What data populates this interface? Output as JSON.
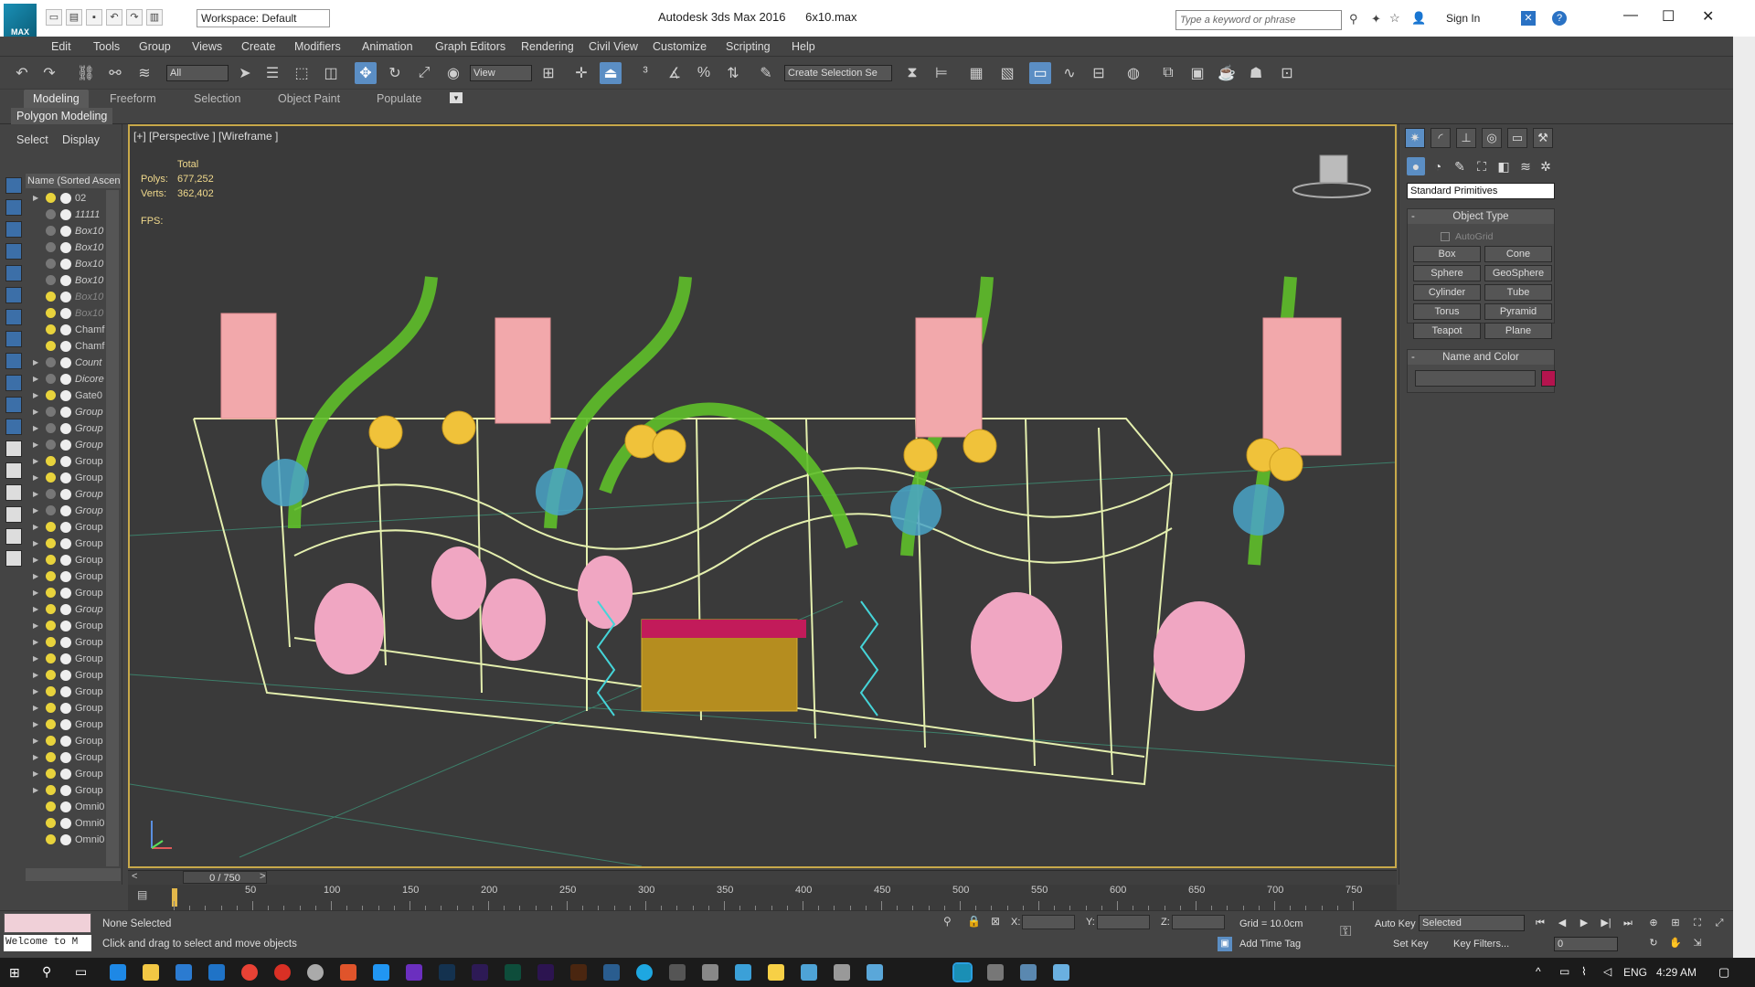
{
  "titlebar": {
    "app_title": "Autodesk 3ds Max 2016",
    "file_name": "6x10.max",
    "workspace": "Workspace: Default",
    "search_placeholder": "Type a keyword or phrase",
    "sign_in": "Sign In",
    "logo_text": "MAX"
  },
  "menu": [
    "Edit",
    "Tools",
    "Group",
    "Views",
    "Create",
    "Modifiers",
    "Animation",
    "Graph Editors",
    "Rendering",
    "Civil View",
    "Customize",
    "Scripting",
    "Help"
  ],
  "toolbar": {
    "selection_filter": "All",
    "ref_coord": "View",
    "named_selection": "Create Selection Se"
  },
  "ribbon": {
    "tabs": [
      "Modeling",
      "Freeform",
      "Selection",
      "Object Paint",
      "Populate"
    ],
    "active_tab": "Modeling",
    "sub": "Polygon Modeling"
  },
  "scene_explorer": {
    "tabs": [
      "Select",
      "Display"
    ],
    "column_header": "Name (Sorted Ascen",
    "items": [
      {
        "name": "02",
        "expand": true,
        "bulb": true,
        "italic": false,
        "dim": false
      },
      {
        "name": "11111",
        "expand": false,
        "bulb": false,
        "italic": true,
        "dim": false
      },
      {
        "name": "Box10",
        "expand": false,
        "bulb": false,
        "italic": true,
        "dim": false
      },
      {
        "name": "Box10",
        "expand": false,
        "bulb": false,
        "italic": true,
        "dim": false
      },
      {
        "name": "Box10",
        "expand": false,
        "bulb": false,
        "italic": true,
        "dim": false
      },
      {
        "name": "Box10",
        "expand": false,
        "bulb": false,
        "italic": true,
        "dim": false
      },
      {
        "name": "Box10",
        "expand": false,
        "bulb": true,
        "italic": true,
        "dim": true
      },
      {
        "name": "Box10",
        "expand": false,
        "bulb": true,
        "italic": true,
        "dim": true
      },
      {
        "name": "Chamf",
        "expand": false,
        "bulb": true,
        "italic": false,
        "dim": false
      },
      {
        "name": "Chamf",
        "expand": false,
        "bulb": true,
        "italic": false,
        "dim": false
      },
      {
        "name": "Count",
        "expand": true,
        "bulb": false,
        "italic": true,
        "dim": false
      },
      {
        "name": "Dicore",
        "expand": true,
        "bulb": false,
        "italic": true,
        "dim": false
      },
      {
        "name": "Gate0",
        "expand": true,
        "bulb": true,
        "italic": false,
        "dim": false
      },
      {
        "name": "Group",
        "expand": true,
        "bulb": false,
        "italic": true,
        "dim": false
      },
      {
        "name": "Group",
        "expand": true,
        "bulb": false,
        "italic": true,
        "dim": false
      },
      {
        "name": "Group",
        "expand": true,
        "bulb": false,
        "italic": true,
        "dim": false
      },
      {
        "name": "Group",
        "expand": true,
        "bulb": true,
        "italic": false,
        "dim": false
      },
      {
        "name": "Group",
        "expand": true,
        "bulb": true,
        "italic": false,
        "dim": false
      },
      {
        "name": "Group",
        "expand": true,
        "bulb": false,
        "italic": true,
        "dim": false
      },
      {
        "name": "Group",
        "expand": true,
        "bulb": false,
        "italic": true,
        "dim": false
      },
      {
        "name": "Group",
        "expand": true,
        "bulb": true,
        "italic": false,
        "dim": false
      },
      {
        "name": "Group",
        "expand": true,
        "bulb": true,
        "italic": false,
        "dim": false
      },
      {
        "name": "Group",
        "expand": true,
        "bulb": true,
        "italic": false,
        "dim": false
      },
      {
        "name": "Group",
        "expand": true,
        "bulb": true,
        "italic": false,
        "dim": false
      },
      {
        "name": "Group",
        "expand": true,
        "bulb": true,
        "italic": false,
        "dim": false
      },
      {
        "name": "Group",
        "expand": true,
        "bulb": true,
        "italic": true,
        "dim": false
      },
      {
        "name": "Group",
        "expand": true,
        "bulb": true,
        "italic": false,
        "dim": false
      },
      {
        "name": "Group",
        "expand": true,
        "bulb": true,
        "italic": false,
        "dim": false
      },
      {
        "name": "Group",
        "expand": true,
        "bulb": true,
        "italic": false,
        "dim": false
      },
      {
        "name": "Group",
        "expand": true,
        "bulb": true,
        "italic": false,
        "dim": false
      },
      {
        "name": "Group",
        "expand": true,
        "bulb": true,
        "italic": false,
        "dim": false
      },
      {
        "name": "Group",
        "expand": true,
        "bulb": true,
        "italic": false,
        "dim": false
      },
      {
        "name": "Group",
        "expand": true,
        "bulb": true,
        "italic": false,
        "dim": false
      },
      {
        "name": "Group",
        "expand": true,
        "bulb": true,
        "italic": false,
        "dim": false
      },
      {
        "name": "Group",
        "expand": true,
        "bulb": true,
        "italic": false,
        "dim": false
      },
      {
        "name": "Group",
        "expand": true,
        "bulb": true,
        "italic": false,
        "dim": false
      },
      {
        "name": "Group",
        "expand": true,
        "bulb": true,
        "italic": false,
        "dim": false
      },
      {
        "name": "Omni0",
        "expand": false,
        "bulb": true,
        "italic": false,
        "dim": false
      },
      {
        "name": "Omni0",
        "expand": false,
        "bulb": true,
        "italic": false,
        "dim": false
      },
      {
        "name": "Omni0",
        "expand": false,
        "bulb": true,
        "italic": false,
        "dim": false
      }
    ]
  },
  "viewport": {
    "label": "[+] [Perspective ] [Wireframe ]",
    "stats_header": "Total",
    "polys_label": "Polys:",
    "polys": "677,252",
    "verts_label": "Verts:",
    "verts": "362,402",
    "fps_label": "FPS:"
  },
  "command_panel": {
    "primitive_type": "Standard Primitives",
    "object_type_title": "Object Type",
    "autogrid": "AutoGrid",
    "buttons": [
      "Box",
      "Cone",
      "Sphere",
      "GeoSphere",
      "Cylinder",
      "Tube",
      "Torus",
      "Pyramid",
      "Teapot",
      "Plane"
    ],
    "name_color_title": "Name and Color",
    "color": "#b4144e"
  },
  "timeline": {
    "frame": "0 / 750",
    "ticks": [
      50,
      100,
      150,
      200,
      250,
      300,
      350,
      400,
      450,
      500,
      550,
      600,
      650,
      700,
      750
    ]
  },
  "status": {
    "welcome": "Welcome to M",
    "selection": "None Selected",
    "prompt": "Click and drag to select and move objects",
    "x_label": "X:",
    "y_label": "Y:",
    "z_label": "Z:",
    "grid": "Grid = 10.0cm",
    "add_time_tag": "Add Time Tag",
    "auto_key": "Auto Key",
    "set_key": "Set Key",
    "key_mode": "Selected",
    "key_filters": "Key Filters...",
    "current_frame": "0"
  },
  "taskbar": {
    "lang": "ENG",
    "time": "4:29 AM"
  }
}
